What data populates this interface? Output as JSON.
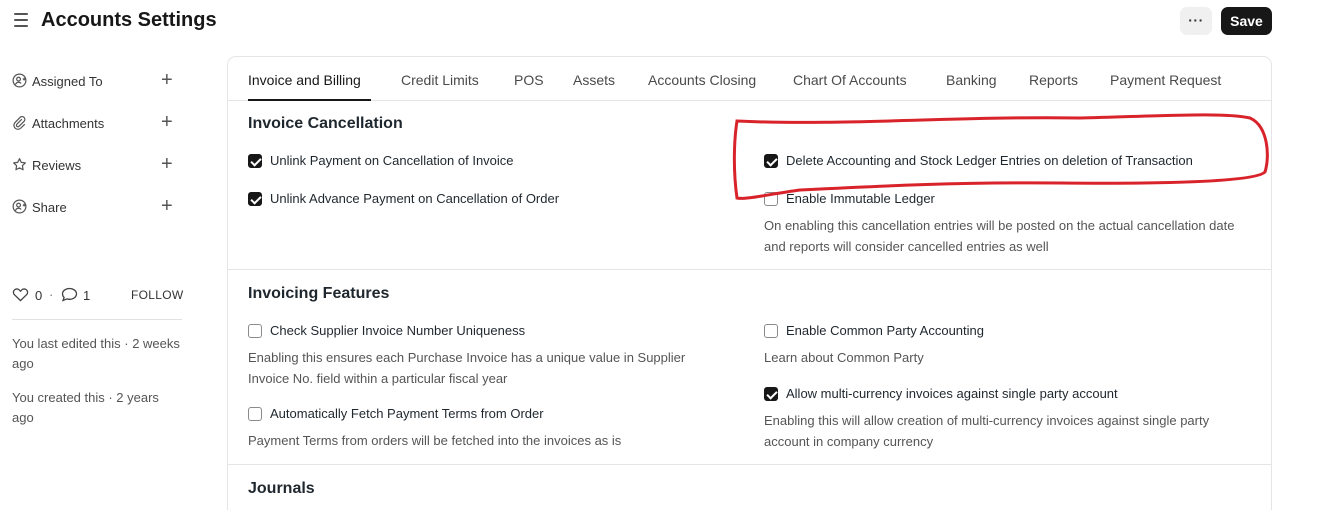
{
  "header": {
    "title": "Accounts Settings",
    "more_label": "···",
    "save_label": "Save"
  },
  "sidebar": {
    "items": [
      {
        "label": "Assigned To",
        "icon": "user-add-icon"
      },
      {
        "label": "Attachments",
        "icon": "paperclip-icon"
      },
      {
        "label": "Reviews",
        "icon": "star-icon"
      },
      {
        "label": "Share",
        "icon": "share-user-icon"
      }
    ],
    "likes": "0",
    "separator": "·",
    "comments": "1",
    "follow_label": "FOLLOW",
    "last_edited": "You last edited this · 2 weeks ago",
    "created": "You created this · 2 years ago"
  },
  "tabs": [
    "Invoice and Billing",
    "Credit Limits",
    "POS",
    "Assets",
    "Accounts Closing",
    "Chart Of Accounts",
    "Banking",
    "Reports",
    "Payment Request"
  ],
  "sections": {
    "invoice_cancellation": {
      "title": "Invoice Cancellation",
      "unlink_payment": {
        "label": "Unlink Payment on Cancellation of Invoice",
        "checked": true
      },
      "unlink_advance": {
        "label": "Unlink Advance Payment on Cancellation of Order",
        "checked": true
      },
      "delete_ledger": {
        "label": "Delete Accounting and Stock Ledger Entries on deletion of Transaction",
        "checked": true
      },
      "immutable_ledger": {
        "label": "Enable Immutable Ledger",
        "checked": false,
        "description": "On enabling this cancellation entries will be posted on the actual cancellation date and reports will consider cancelled entries as well"
      }
    },
    "invoicing_features": {
      "title": "Invoicing Features",
      "supplier_uniqueness": {
        "label": "Check Supplier Invoice Number Uniqueness",
        "checked": false,
        "description": "Enabling this ensures each Purchase Invoice has a unique value in Supplier Invoice No. field within a particular fiscal year"
      },
      "fetch_payment_terms": {
        "label": "Automatically Fetch Payment Terms from Order",
        "checked": false,
        "description": "Payment Terms from orders will be fetched into the invoices as is"
      },
      "common_party": {
        "label": "Enable Common Party Accounting",
        "checked": false,
        "description": "Learn about Common Party"
      },
      "multi_currency": {
        "label": "Allow multi-currency invoices against single party account",
        "checked": true,
        "description": "Enabling this will allow creation of multi-currency invoices against single party account in company currency"
      }
    },
    "journals": {
      "title": "Journals"
    }
  },
  "colors": {
    "accent": "#171717",
    "annotation": "#d9232b",
    "border": "#e5e5e5"
  }
}
